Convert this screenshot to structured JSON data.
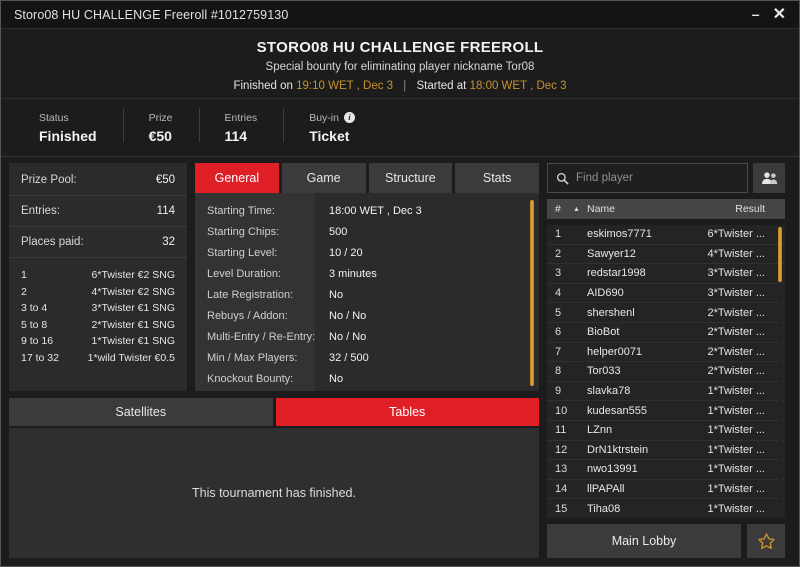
{
  "window": {
    "title": "Storo08 HU CHALLENGE Freeroll #1012759130",
    "minimize_label": "–",
    "close_label": "✕"
  },
  "header": {
    "title": "STORO08 HU CHALLENGE FREEROLL",
    "subtitle": "Special bounty for eliminating player nickname Tor08",
    "finished_prefix": "Finished on",
    "finished_time": "19:10 WET , Dec 3",
    "separator": "|",
    "started_prefix": "Started at",
    "started_time": "18:00 WET , Dec 3",
    "accent_color": "#c8922e"
  },
  "status_strip": [
    {
      "label": "Status",
      "value": "Finished",
      "icon": ""
    },
    {
      "label": "Prize",
      "value": "€50",
      "icon": ""
    },
    {
      "label": "Entries",
      "value": "114",
      "icon": ""
    },
    {
      "label": "Buy-in",
      "value": "Ticket",
      "icon": "info-icon"
    }
  ],
  "prize_panel": {
    "summary": [
      {
        "label": "Prize Pool:",
        "value": "€50"
      },
      {
        "label": "Entries:",
        "value": "114"
      },
      {
        "label": "Places paid:",
        "value": "32"
      }
    ],
    "payouts": [
      {
        "place": "1",
        "prize": "6*Twister €2 SNG"
      },
      {
        "place": "2",
        "prize": "4*Twister €2 SNG"
      },
      {
        "place": "3  to  4",
        "prize": "3*Twister €1 SNG"
      },
      {
        "place": "5  to  8",
        "prize": "2*Twister €1 SNG"
      },
      {
        "place": "9  to  16",
        "prize": "1*Twister €1 SNG"
      },
      {
        "place": "17  to  32",
        "prize": "1*wild Twister €0.5"
      }
    ]
  },
  "detail_tabs": [
    {
      "label": "General",
      "active": true
    },
    {
      "label": "Game",
      "active": false
    },
    {
      "label": "Structure",
      "active": false
    },
    {
      "label": "Stats",
      "active": false
    }
  ],
  "details": [
    {
      "label": "Starting Time:",
      "value": "18:00 WET , Dec 3"
    },
    {
      "label": "Starting Chips:",
      "value": "500"
    },
    {
      "label": "Starting Level:",
      "value": "10 / 20"
    },
    {
      "label": "Level Duration:",
      "value": "3 minutes"
    },
    {
      "label": "Late Registration:",
      "value": "No"
    },
    {
      "label": "Rebuys / Addon:",
      "value": "No / No"
    },
    {
      "label": "Multi-Entry / Re-Entry:",
      "value": "No / No"
    },
    {
      "label": "Min / Max Players:",
      "value": "32 / 500"
    },
    {
      "label": "Knockout Bounty:",
      "value": "No"
    }
  ],
  "bottom_tabs": [
    {
      "label": "Satellites",
      "active": false
    },
    {
      "label": "Tables",
      "active": true
    }
  ],
  "bottom_message": "This tournament has finished.",
  "search": {
    "placeholder": "Find player",
    "value": "",
    "search_icon": "search-icon",
    "people_icon": "people-icon"
  },
  "player_columns": {
    "num": "#",
    "sort": "▲",
    "name": "Name",
    "result": "Result"
  },
  "players": [
    {
      "num": "1",
      "name": "eskimos7771",
      "result": "6*Twister ..."
    },
    {
      "num": "2",
      "name": "Sawyer12",
      "result": "4*Twister ..."
    },
    {
      "num": "3",
      "name": "redstar1998",
      "result": "3*Twister ..."
    },
    {
      "num": "4",
      "name": "AID690",
      "result": "3*Twister ..."
    },
    {
      "num": "5",
      "name": "shershenl",
      "result": "2*Twister ..."
    },
    {
      "num": "6",
      "name": "BioBot",
      "result": "2*Twister ..."
    },
    {
      "num": "7",
      "name": "helper0071",
      "result": "2*Twister ..."
    },
    {
      "num": "8",
      "name": "Tor033",
      "result": "2*Twister ..."
    },
    {
      "num": "9",
      "name": "slavka78",
      "result": "1*Twister ..."
    },
    {
      "num": "10",
      "name": "kudesan555",
      "result": "1*Twister ..."
    },
    {
      "num": "11",
      "name": "LZnn",
      "result": "1*Twister ..."
    },
    {
      "num": "12",
      "name": "DrN1ktrstein",
      "result": "1*Twister ..."
    },
    {
      "num": "13",
      "name": "nwo13991",
      "result": "1*Twister ..."
    },
    {
      "num": "14",
      "name": "llPAPAll",
      "result": "1*Twister ..."
    },
    {
      "num": "15",
      "name": "Tiha08",
      "result": "1*Twister ..."
    }
  ],
  "footer": {
    "main_lobby_label": "Main Lobby",
    "star_icon": "star-icon"
  },
  "colors": {
    "accent_red": "#e01e26",
    "accent_gold": "#c8922e",
    "panel_bg": "#2b2b2b",
    "window_bg": "#1c1c1c"
  }
}
